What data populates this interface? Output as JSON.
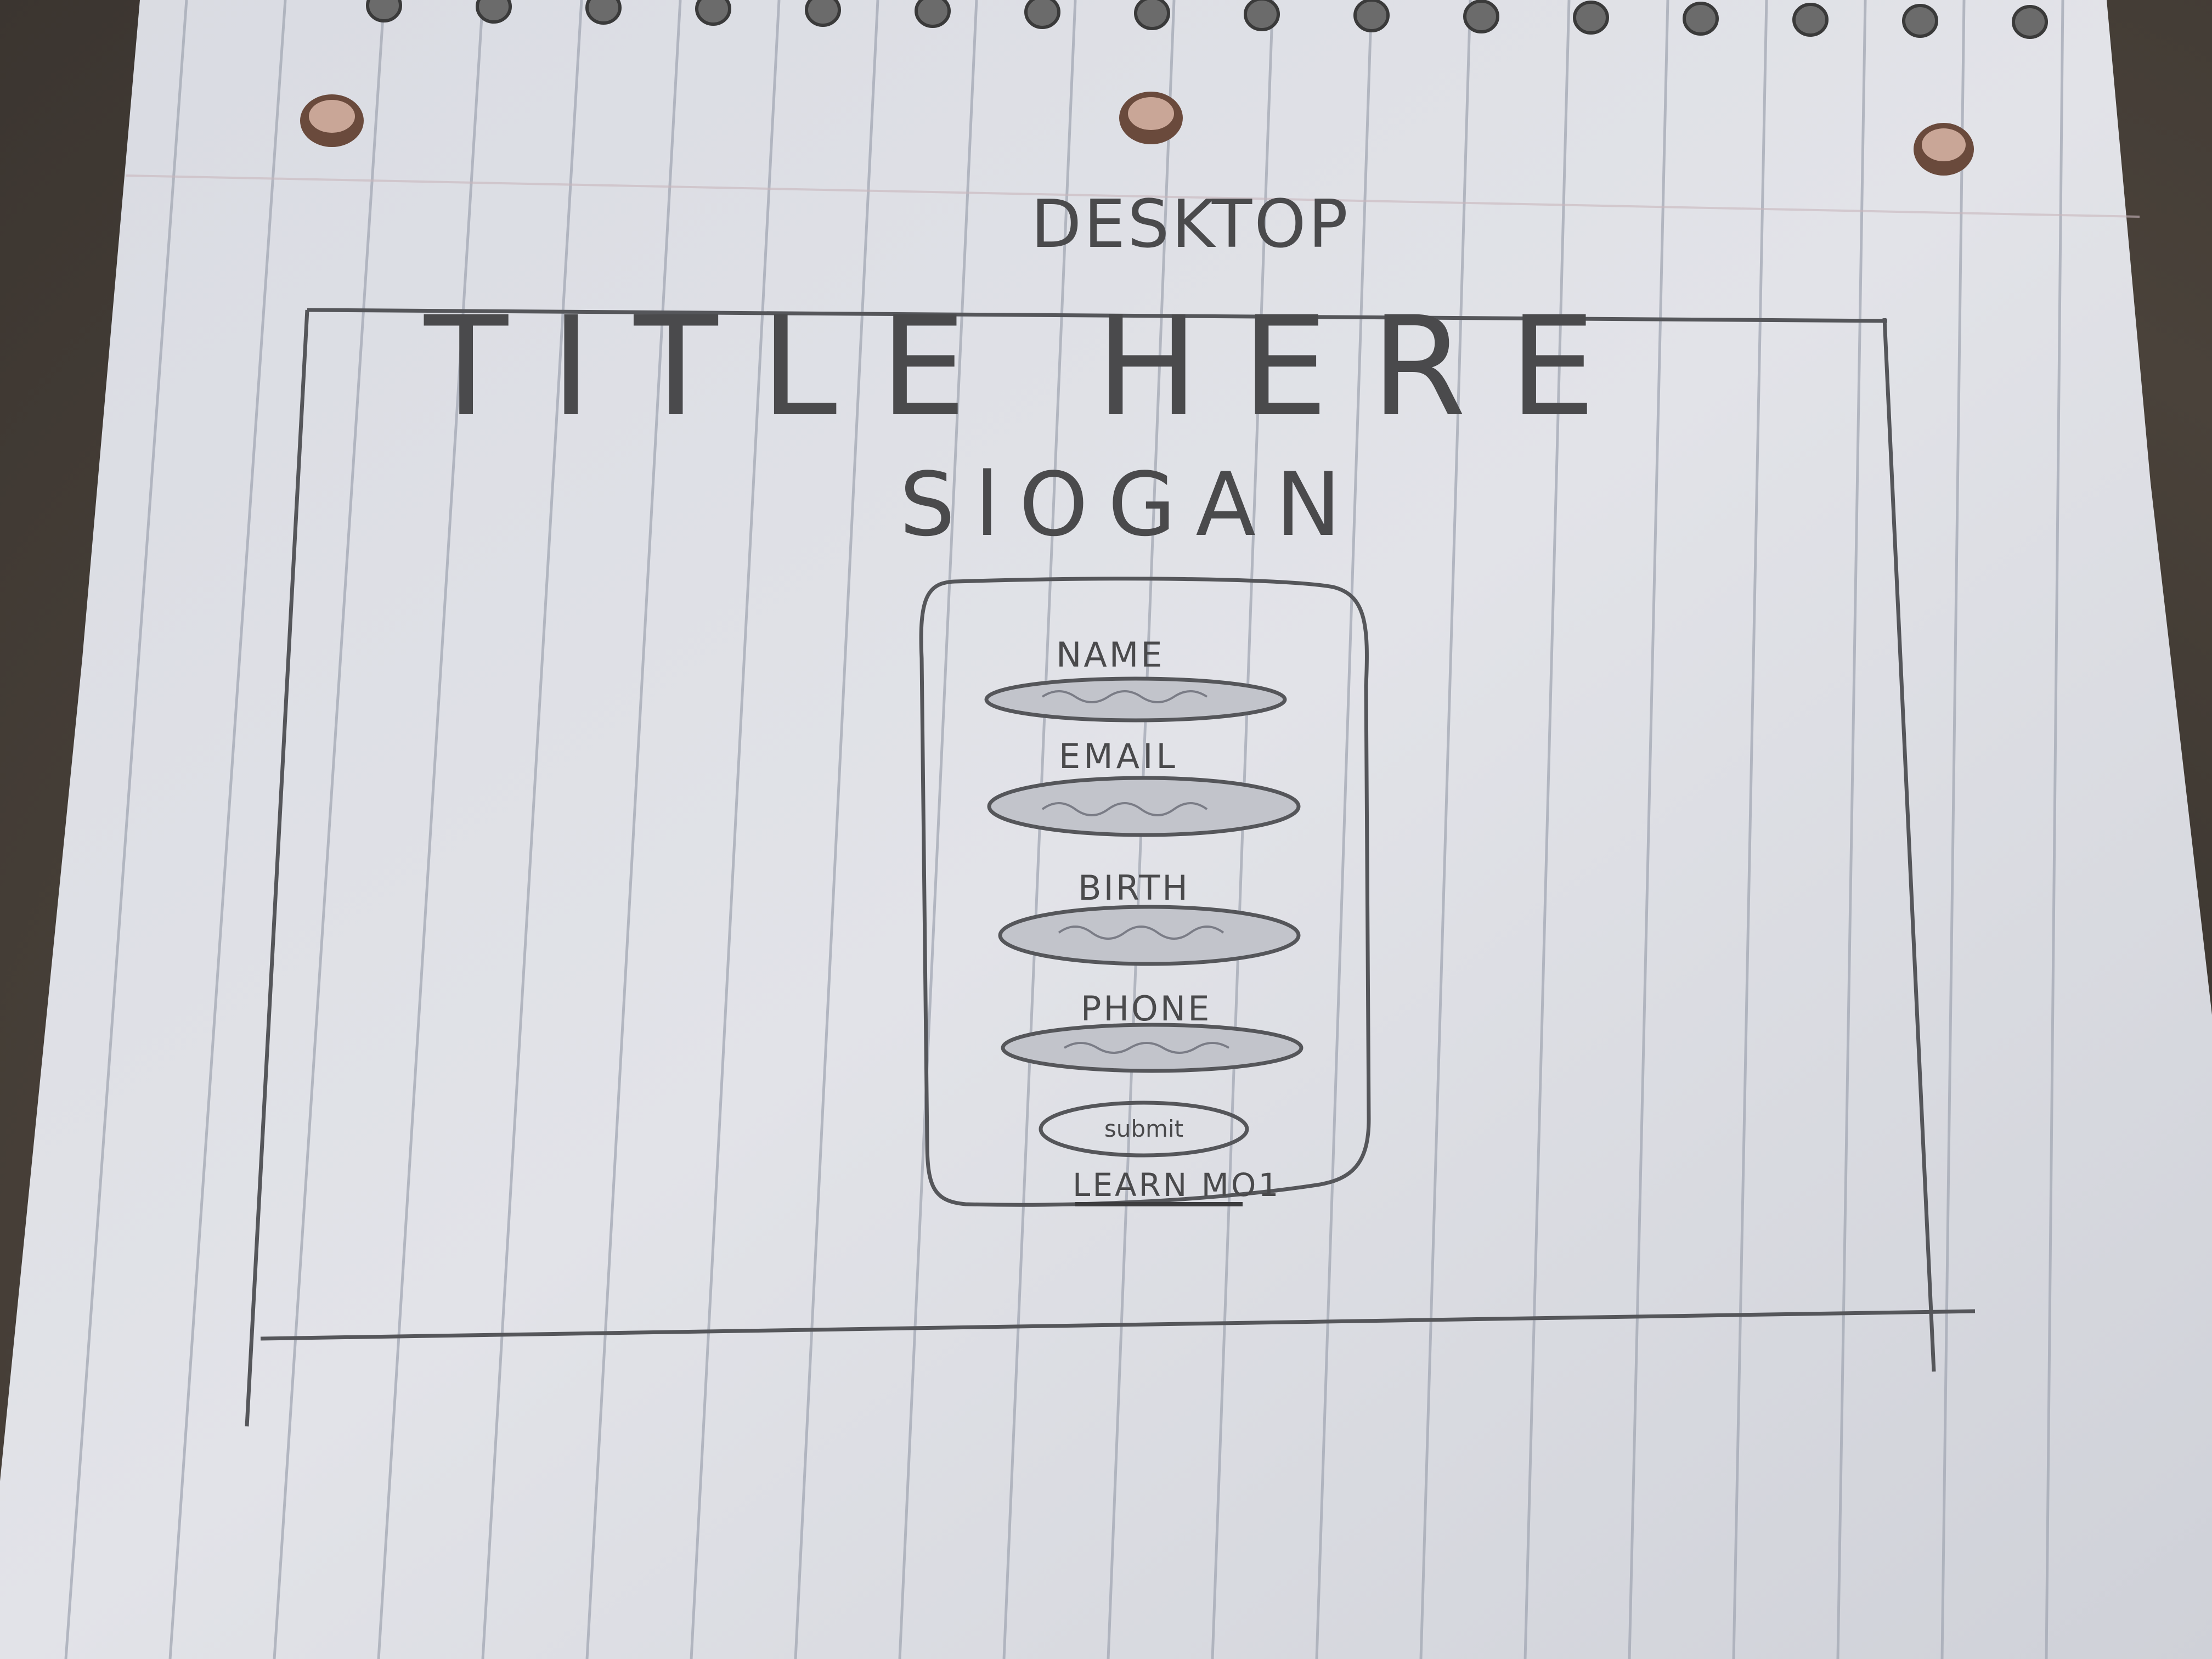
{
  "sketch": {
    "page_label": "DESKTOP",
    "title": "TITLE HERE",
    "slogan": "SlOGAN",
    "form": {
      "fields": [
        {
          "label": "NAME"
        },
        {
          "label": "EMAIL"
        },
        {
          "label": "BIRTH"
        },
        {
          "label": "PHONE"
        }
      ],
      "submit_label": "submit",
      "link_label": "LEARN MO1"
    }
  },
  "colors": {
    "paper": "#dcdde2",
    "rule_lines": "#9aa0ad",
    "pencil": "#4a4a4c",
    "background": "#3a3530"
  }
}
